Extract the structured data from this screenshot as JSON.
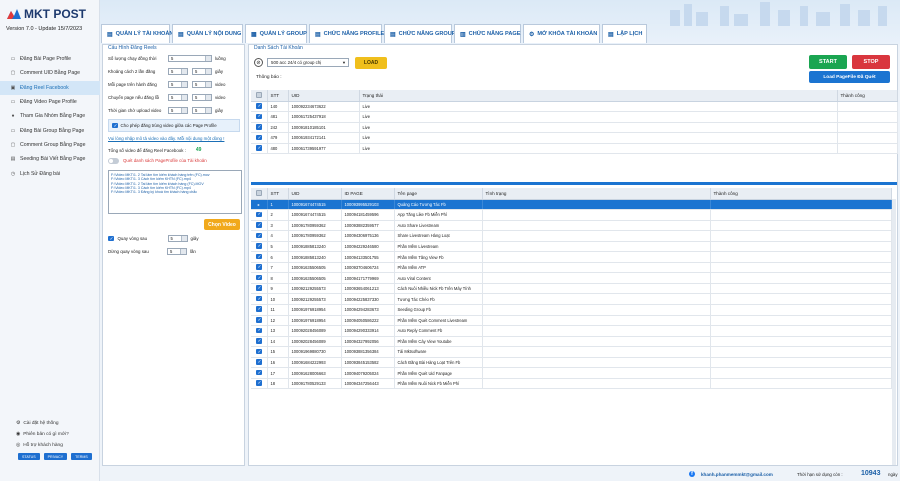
{
  "app": {
    "logo_text": "MKT POST",
    "version_line": "Version  7.0  - Update  15/7/2023"
  },
  "sidebar": {
    "items": [
      {
        "label": "Đăng Bài Page Profile",
        "icon": "page-icon"
      },
      {
        "label": "Comment UID Bằng Page",
        "icon": "comment-icon"
      },
      {
        "label": "Đăng Reel Facebook",
        "icon": "reel-icon",
        "active": true
      },
      {
        "label": "Đăng Video Page Profile",
        "icon": "video-icon"
      },
      {
        "label": "Tham Gia Nhóm Bằng Page",
        "icon": "group-icon"
      },
      {
        "label": "Đăng Bài Group Bằng Page",
        "icon": "group-post-icon"
      },
      {
        "label": "Comment Group Bằng Page",
        "icon": "comment-group-icon"
      },
      {
        "label": "Seeding Bài Viết Bằng Page",
        "icon": "seeding-icon"
      },
      {
        "label": "Lịch Sử Đăng bài",
        "icon": "history-icon"
      }
    ],
    "footer": [
      {
        "label": "Cài đặt hệ thống",
        "icon": "gear-icon"
      },
      {
        "label": "Phiên bản có gì mới?",
        "icon": "info-icon"
      },
      {
        "label": "Hỗ trợ khách hàng",
        "icon": "support-icon"
      }
    ],
    "badges": [
      "STATUS",
      "PRIVACY",
      "TERMS"
    ]
  },
  "tabs": [
    {
      "label": "QUẢN LÝ TÀI KHOẢN",
      "icon": "account-icon"
    },
    {
      "label": "QUẢN LÝ NỘI DUNG",
      "icon": "content-icon"
    },
    {
      "label": "QUẢN LÝ GROUP",
      "icon": "group-icon"
    },
    {
      "label": "CHỨC NĂNG PROFILE",
      "icon": "profile-icon"
    },
    {
      "label": "CHỨC NĂNG GROUP",
      "icon": "group-func-icon"
    },
    {
      "label": "CHỨC NĂNG PAGE",
      "icon": "page-func-icon"
    },
    {
      "label": "MỞ KHÓA TÀI KHOẢN",
      "icon": "unlock-icon"
    },
    {
      "label": "LẬP LỊCH",
      "icon": "schedule-icon"
    }
  ],
  "config": {
    "title": "Cấu Hình Đăng Reels",
    "fields": [
      {
        "label": "Số lượng chạy đồng thời",
        "value": "5",
        "unit": "luồng"
      },
      {
        "label": "Khoảng cách 2 lần đăng",
        "value": "5",
        "value2": "5",
        "unit": "giây"
      },
      {
        "label": "Mỗi page trên hành đăng",
        "value": "5",
        "value2": "5",
        "unit": "video"
      },
      {
        "label": "Chuyển page nếu đăng lỗi",
        "value": "5",
        "value2": "5",
        "unit": "video"
      },
      {
        "label": "Thời gian chờ upload video",
        "value": "5",
        "value2": "5",
        "unit": "giây"
      }
    ],
    "allow_dup_label": "Cho phép đăng trùng video giữa các Page Profile",
    "guide_link": "Vui lòng nhập mô tả video vào đây. Mỗi nội dung một dòng !",
    "total_label": "Tổng số video để đăng Reel Facebook :",
    "total_value": "49",
    "scan_label": "Quét danh sách PageProfile của Tài khoản",
    "files": [
      "F:\\Video MKT\\1. 2 Tai lâm tìm kiếm khách hàng trên (FC).mov",
      "F:\\Video MKT\\1. 3 Cách tìm kiếm KHTN (FC).mp4",
      "F:\\Video MKT\\1. 2 Tai lâm tìm kiếm khách hàng (FC).MOV",
      "F:\\Video MKT\\1. 3 Cách tìm kiếm KHTN (FC).mp4",
      "F:\\Video MKT\\1. 3 Đăng ký khoá tìm khách hàng chắc"
    ],
    "choose_video_label": "Chọn Video",
    "loop_label": "Quay vòng sau",
    "loop_value": "5",
    "loop_unit": "giây",
    "stop_label": "Dừng quay vòng sau",
    "stop_value": "5",
    "stop_unit": "lần"
  },
  "accounts": {
    "title": "Danh Sách Tài Khoản",
    "select_value": "500 acc 24/4 có group chị",
    "load_label": "LOAD",
    "notice_label": "Thông báo :",
    "start_label": "START",
    "stop_label": "STOP",
    "loadpage_label": "Load PageFile Đã Quét",
    "columns": [
      "",
      "STT",
      "UID",
      "Trạng thái",
      "Thành công"
    ],
    "rows": [
      [
        "140",
        "100092234673622",
        "Live"
      ],
      [
        "481",
        "100061725437918",
        "Live"
      ],
      [
        "242",
        "100091810185101",
        "Live"
      ],
      [
        "479",
        "100061934172141",
        "Live"
      ],
      [
        "480",
        "100061739591977",
        "Live"
      ]
    ]
  },
  "pages": {
    "columns": [
      "",
      "STT",
      "UID",
      "ID PAGE",
      "Tên page",
      "Tình trạng",
      "Thành công"
    ],
    "rows": [
      [
        "1",
        "100091674474515",
        "100093995529103",
        "Quảng Cáo Tương Tác Fb"
      ],
      [
        "2",
        "100091674474515",
        "100094181459596",
        "App Tăng Like Fb Miễn Phí"
      ],
      [
        "3",
        "100091780959362",
        "100093882359577",
        "Auto Share Livestream"
      ],
      [
        "4",
        "100091780959362",
        "100094306975136",
        "Share Livestream Hàng Loạt"
      ],
      [
        "5",
        "100091885813240",
        "100094229246580",
        "Phần Mềm Livestream"
      ],
      [
        "6",
        "100091885813240",
        "100094133501755",
        "Phần Mềm Tăng View Fb"
      ],
      [
        "7",
        "100091635506505",
        "100093704606724",
        "Phần Mềm ATP"
      ],
      [
        "8",
        "100091635506505",
        "100094171779969",
        "Auto Viral Content"
      ],
      [
        "9",
        "100092129255573",
        "100093654061213",
        "Cách Nuôi Nhiều Nick Fb Trên Máy Tính"
      ],
      [
        "10",
        "100092129255573",
        "100094225837330",
        "Tương Tác Chéo Fb"
      ],
      [
        "11",
        "100091976918954",
        "100094294283673",
        "Seeding Group Fb"
      ],
      [
        "12",
        "100091976918954",
        "100094050586222",
        "Phần Mềm Quét Comment Livestream"
      ],
      [
        "13",
        "100092028456089",
        "100094290333914",
        "Auto Reply Comment Fb"
      ],
      [
        "14",
        "100092028456089",
        "100094327992056",
        "Phần Mềm Cày View Youtube"
      ],
      [
        "15",
        "100091969880730",
        "100093881356384",
        "Tải Mktsoftware"
      ],
      [
        "16",
        "100091684222993",
        "100093845153582",
        "Cách Đăng Bài Hàng Loạt Trên Fb"
      ],
      [
        "17",
        "100091628005663",
        "100094079205024",
        "Phần Mềm Quét Uid Fanpage"
      ],
      [
        "18",
        "100091780529133",
        "100094347256443",
        "Phần Mềm Nuôi Nick Fb Miễn Phí"
      ]
    ],
    "selected_index": 0
  },
  "statusbar": {
    "email": "khanh.phanmemmkt@gmail.com",
    "remaining_label": "Thời hạn sử dụng còn :",
    "remaining_value": "10943",
    "remaining_unit": "ngày"
  },
  "colors": {
    "primary": "#1b74d1",
    "start": "#1aa551",
    "stop": "#d9363e",
    "load": "#f0bf1c",
    "choose_video": "#f1a91c",
    "total": "#1aa551",
    "scan": "#d93a3a"
  }
}
